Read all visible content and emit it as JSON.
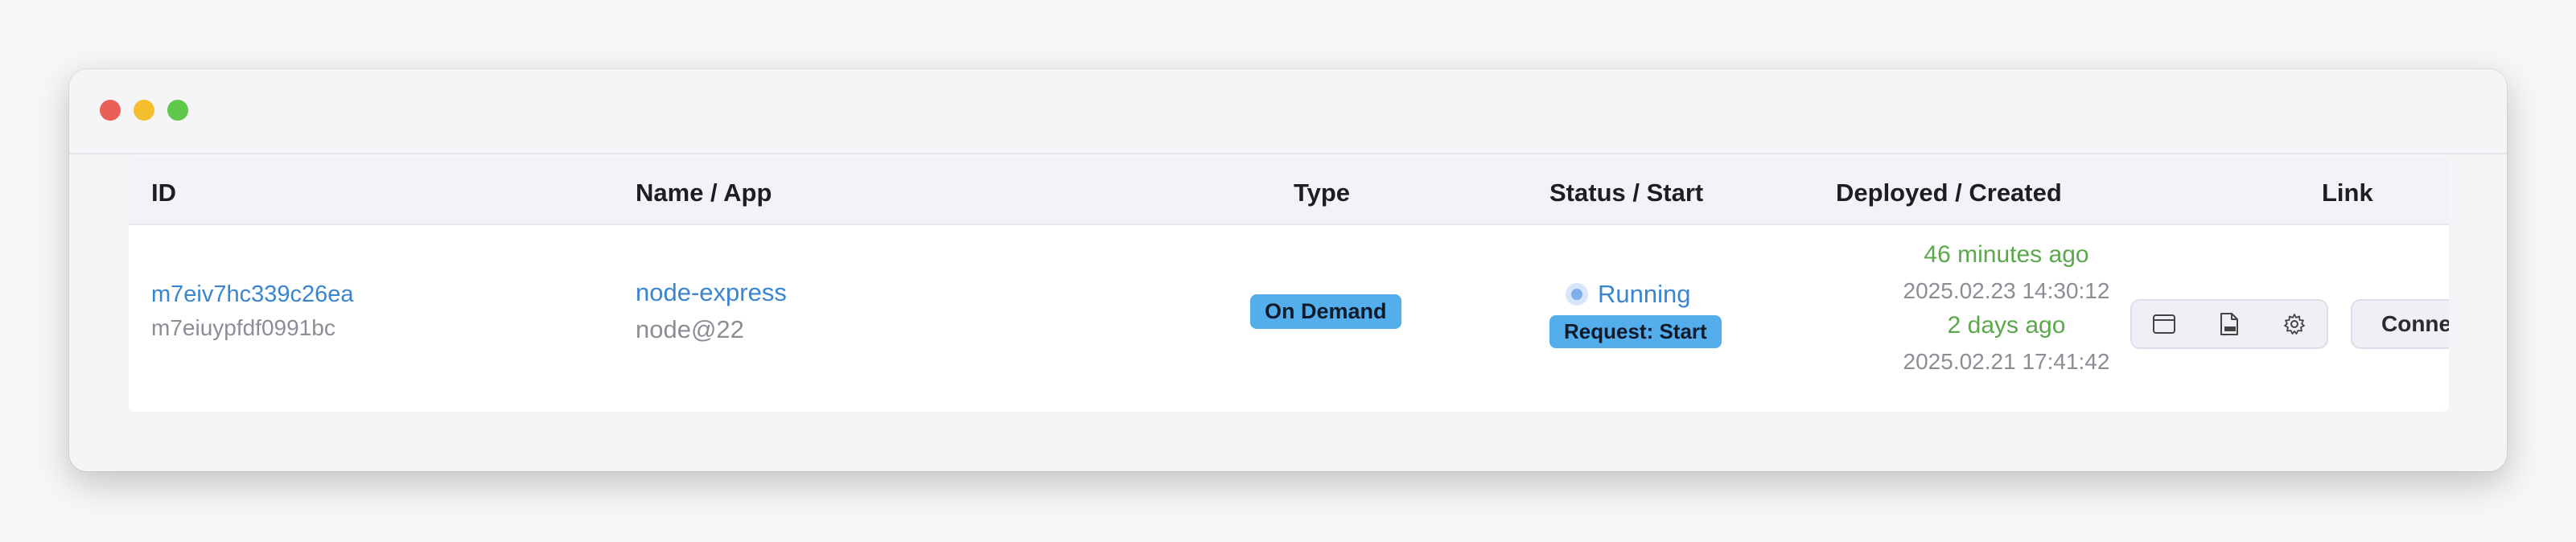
{
  "table": {
    "headers": {
      "id": "ID",
      "name_app": "Name / App",
      "type": "Type",
      "status_start": "Status / Start",
      "deployed_created": "Deployed / Created",
      "link": "Link"
    },
    "rows": [
      {
        "id": "m7eiv7hc339c26ea",
        "sub_id": "m7eiuypfdf0991bc",
        "name": "node-express",
        "app": "node@22",
        "type": "On Demand",
        "status": "Running",
        "start": "Request: Start",
        "deployed_relative": "46 minutes ago",
        "deployed_at": "2025.02.23 14:30:12",
        "created_relative": "2 days ago",
        "created_at": "2025.02.21 17:41:42",
        "actions": {
          "icons": [
            "browser-window-icon",
            "html-file-icon",
            "gear-icon"
          ],
          "connect_label": "Connect"
        }
      }
    ]
  },
  "colors": {
    "link_blue": "#3a85d0",
    "badge_blue": "#55aeec",
    "green": "#5ba84c",
    "muted": "#8d8d96"
  }
}
